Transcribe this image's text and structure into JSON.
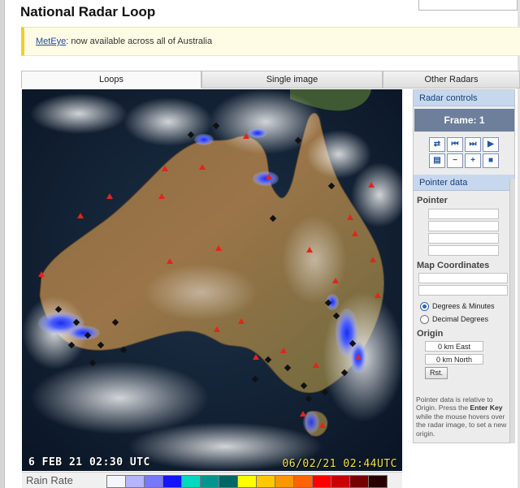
{
  "page": {
    "title": "National Radar Loop"
  },
  "notice": {
    "link_text": "MetEye",
    "rest": ": now available across all of Australia",
    "accent": "#f0cf2a"
  },
  "tabs": [
    {
      "label": "Loops",
      "active": true
    },
    {
      "label": "Single image",
      "active": false
    },
    {
      "label": "Other Radars",
      "active": false
    }
  ],
  "radar": {
    "timestamp_left": "6 FEB 21 02:30 UTC",
    "timestamp_right": "06/02/21 02:44UTC",
    "site_marker_color": "#e5231b",
    "rain_color_light": "#aab4ff",
    "rain_color_heavy": "#1a2cf0"
  },
  "rain_rate": {
    "label": "Rain Rate",
    "colors": [
      "#f5f5ff",
      "#b4b4ff",
      "#7878ff",
      "#1414ff",
      "#00d8c3",
      "#009690",
      "#006666",
      "#ffff00",
      "#ffc800",
      "#ff9600",
      "#ff6400",
      "#ff0000",
      "#c80000",
      "#780000",
      "#280000"
    ]
  },
  "panel": {
    "controls_title": "Radar controls",
    "frame_label": "Frame: 1",
    "controls": [
      {
        "name": "loop-toggle-icon",
        "glyph": "⇄"
      },
      {
        "name": "first-frame-icon",
        "glyph": "⏮"
      },
      {
        "name": "step-forward-icon",
        "glyph": "⏭"
      },
      {
        "name": "play-icon",
        "glyph": "▶"
      },
      {
        "name": "print-icon",
        "glyph": "▤"
      },
      {
        "name": "zoom-out-icon",
        "glyph": "−"
      },
      {
        "name": "zoom-in-icon",
        "glyph": "+"
      },
      {
        "name": "stop-icon",
        "glyph": "■"
      }
    ],
    "pointer_title": "Pointer data",
    "pointer_label": "Pointer",
    "map_coords_label": "Map Coordinates",
    "radio_dm": "Degrees & Minutes",
    "radio_dd": "Decimal Degrees",
    "origin_label": "Origin",
    "origin_east": "0 km East",
    "origin_north": "0 km North",
    "reset_label": "Rst.",
    "help_prefix": "Pointer data is relative to Origin. Press the ",
    "help_key": "Enter Key",
    "help_suffix": " while the mouse hovers over the radar image, to set a new origin."
  }
}
